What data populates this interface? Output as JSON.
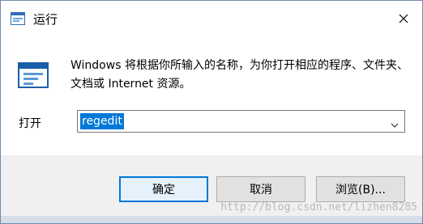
{
  "window": {
    "title": "运行",
    "close_symbol": "✕"
  },
  "dialog": {
    "description": "Windows 将根据你所输入的名称，为你打开相应的程序、文件夹、文档或 Internet 资源。",
    "open_label": "打开",
    "command_value": "regedit"
  },
  "buttons": {
    "ok": "确定",
    "cancel": "取消",
    "browse": "浏览(B)..."
  },
  "watermark": "http://blog.csdn.net/lizhen8285",
  "colors": {
    "accent": "#0078d7",
    "footer_bg": "#f0f0f0"
  },
  "icons": {
    "title": "run-app-icon",
    "dialog": "run-app-icon",
    "close": "close-icon",
    "dropdown": "chevron-down-icon"
  }
}
